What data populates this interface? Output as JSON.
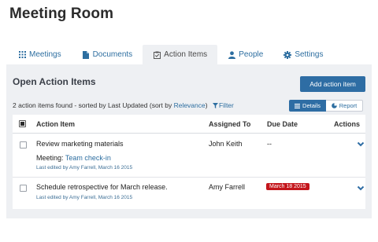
{
  "page": {
    "title": "Meeting Room"
  },
  "tabs": [
    {
      "label": "Meetings",
      "icon": "grid-icon",
      "active": false
    },
    {
      "label": "Documents",
      "icon": "document-icon",
      "active": false
    },
    {
      "label": "Action Items",
      "icon": "clipboard-check-icon",
      "active": true
    },
    {
      "label": "People",
      "icon": "person-icon",
      "active": false
    },
    {
      "label": "Settings",
      "icon": "gear-icon",
      "active": false
    }
  ],
  "section": {
    "title": "Open Action Items",
    "add_button": "Add action item"
  },
  "summary": {
    "prefix": "2 action items found - sorted by Last Updated (sort by ",
    "relevance_link": "Relevance",
    "suffix": ")",
    "filter_label": "Filter"
  },
  "view_toggle": {
    "details": "Details",
    "report": "Report"
  },
  "table": {
    "headers": {
      "action_item": "Action Item",
      "assigned_to": "Assigned To",
      "due_date": "Due Date",
      "actions": "Actions"
    },
    "rows": [
      {
        "title": "Review marketing materials",
        "assigned_to": "John Keith",
        "due_date": "--",
        "meeting_prefix": "Meeting: ",
        "meeting_link": "Team check-in",
        "last_edited": "Last edited by Amy Farrell, March 16 2015"
      },
      {
        "title": "Schedule retrospective for March release.",
        "assigned_to": "Amy Farrell",
        "due_date": "March 18 2015",
        "last_edited": "Last edited by Amy Farrell, March 16 2015"
      }
    ]
  },
  "colors": {
    "primary": "#2e6da4",
    "link": "#2d6ea0",
    "panel_bg": "#eef0f3",
    "overdue_badge": "#c4161c"
  }
}
